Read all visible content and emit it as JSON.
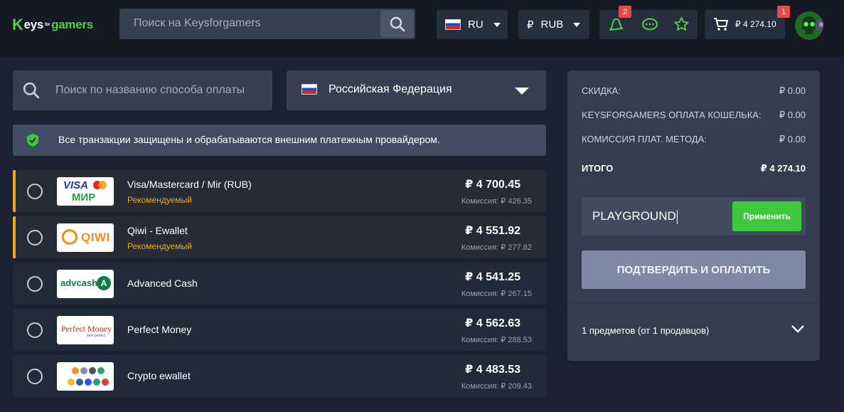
{
  "header": {
    "logo": {
      "k": "K",
      "eys": "eys",
      "for": "for",
      "gamers": "gamers"
    },
    "search_placeholder": "Поиск на Keysforgamers",
    "language": "RU",
    "currency_symbol": "₽",
    "currency": "RUB",
    "notifications_badge": "2",
    "cart_badge": "1",
    "cart_amount": "₽ 4 274.10"
  },
  "payment_search_placeholder": "Поиск по названию способа оплаты",
  "country": "Российская Федерация",
  "notice": "Все транзакции защищены и обрабатываются внешним платежным провайдером.",
  "fee_label": "Комиссия:",
  "methods": [
    {
      "name": "Visa/Mastercard / Mir (RUB)",
      "tag": "Рекомендуемый",
      "price": "₽ 4 700.45",
      "fee": "₽ 426.35",
      "logo_lines": [
        "VISA",
        "МИР"
      ]
    },
    {
      "name": "Qiwi - Ewallet",
      "tag": "Рекомендуемый",
      "price": "₽ 4 551.92",
      "fee": "₽ 277.82",
      "logo_lines": [
        "QIWI"
      ]
    },
    {
      "name": "Advanced Cash",
      "tag": "",
      "price": "₽ 4 541.25",
      "fee": "₽ 267.15",
      "logo_lines": [
        "advcash"
      ]
    },
    {
      "name": "Perfect Money",
      "tag": "",
      "price": "₽ 4 562.63",
      "fee": "₽ 288.53",
      "logo_lines": [
        "Perfect Money",
        "best perfect"
      ]
    },
    {
      "name": "Crypto ewallet",
      "tag": "",
      "price": "₽ 4 483.53",
      "fee": "₽ 209.43",
      "logo_lines": []
    }
  ],
  "summary": {
    "discount_label": "СКИДКА:",
    "discount_value": "₽ 0.00",
    "wallet_label": "KEYSFORGAMERS ОПЛАТА КОШЕЛЬКА:",
    "wallet_value": "₽ 0.00",
    "method_fee_label": "КОМИССИЯ ПЛАТ. МЕТОДА:",
    "method_fee_value": "₽ 0.00",
    "total_label": "ИТОГО",
    "total_value": "₽ 4 274.10",
    "coupon_value": "PLAYGROUND",
    "apply_label": "Применить",
    "confirm_label": "ПОДТВЕРДИТЬ И ОПЛАТИТЬ",
    "items_label": "1 предметов (от 1 продавцов)"
  },
  "colors": {
    "accent_green": "#3ec83d",
    "recommended_orange": "#f0a81a",
    "badge_red": "#e14b4b"
  }
}
